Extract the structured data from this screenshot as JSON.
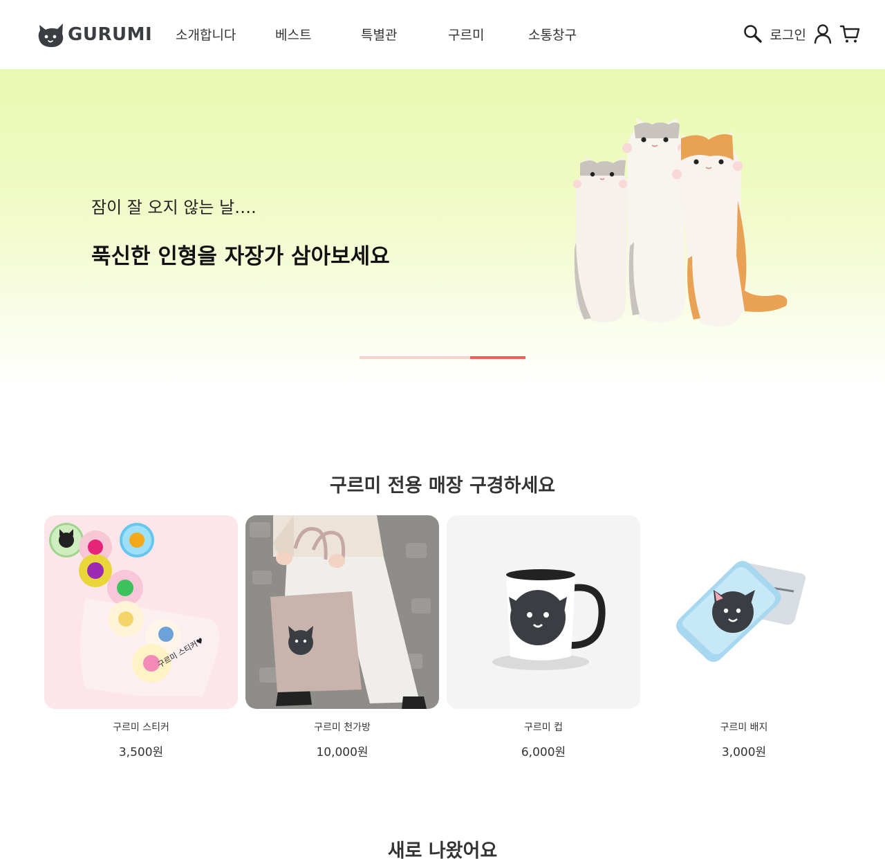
{
  "brand": {
    "name": "GURUMI"
  },
  "nav": {
    "items": [
      {
        "label": "소개합니다"
      },
      {
        "label": "베스트"
      },
      {
        "label": "특별관"
      },
      {
        "label": "구르미"
      },
      {
        "label": "소통창구"
      }
    ]
  },
  "util": {
    "search_icon": "search-icon",
    "login_label": "로그인",
    "user_icon": "user-icon",
    "cart_icon": "cart-icon"
  },
  "hero": {
    "subtitle": "잠이 잘 오지 않는 날….",
    "title": "푹신한 인형을 자장가 삼아보세요",
    "slides_total": 3,
    "active_slide": 3,
    "colors": {
      "top": "#e9f9b2",
      "indicator_track": "#f8d3cd",
      "indicator_active": "#ef5f58"
    }
  },
  "shop": {
    "title": "구르미 전용 매장 구경하세요",
    "products": [
      {
        "name": "구르미 스티커",
        "price": "3,500원",
        "sticker_text": "구르미 스티커♥"
      },
      {
        "name": "구르미 천가방",
        "price": "10,000원"
      },
      {
        "name": "구르미 컵",
        "price": "6,000원"
      },
      {
        "name": "구르미 배지",
        "price": "3,000원"
      }
    ]
  },
  "new_section": {
    "title": "새로 나왔어요"
  }
}
